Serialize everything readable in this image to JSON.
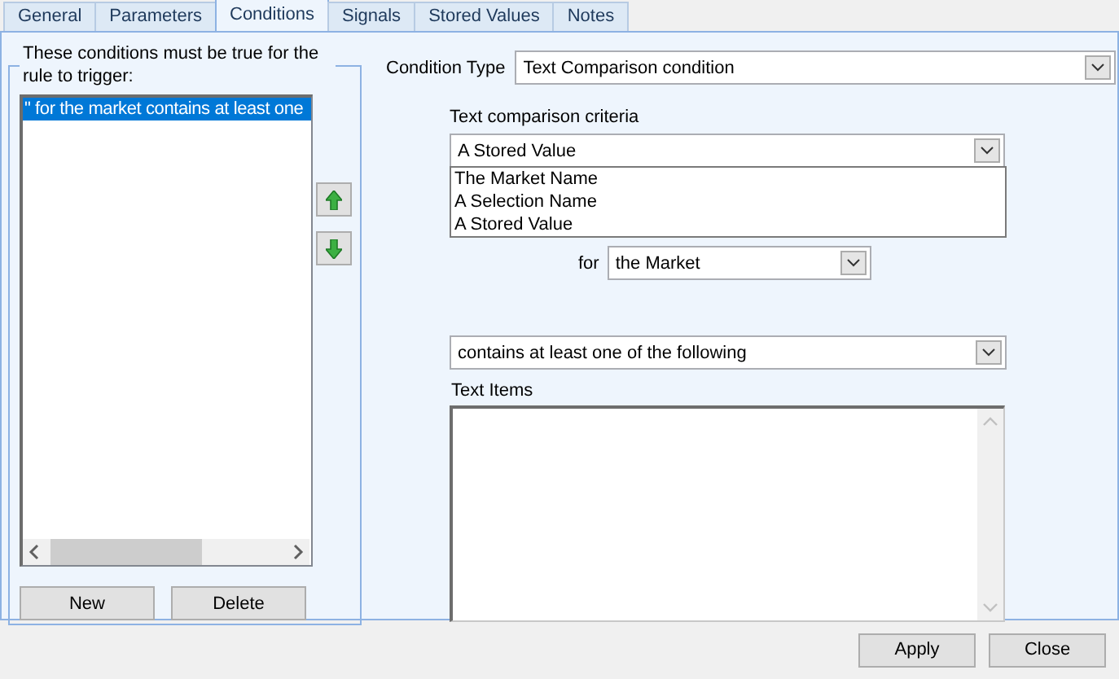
{
  "tabs": [
    {
      "label": "General",
      "selected": false
    },
    {
      "label": "Parameters",
      "selected": false
    },
    {
      "label": "Conditions",
      "selected": true
    },
    {
      "label": "Signals",
      "selected": false
    },
    {
      "label": "Stored Values",
      "selected": false
    },
    {
      "label": "Notes",
      "selected": false
    }
  ],
  "conditions_group": {
    "legend": "These conditions must be true for the rule to trigger:",
    "items": [
      {
        "text": "\" for the market contains at least one",
        "selected": true
      }
    ],
    "buttons": [
      "New",
      "Delete"
    ]
  },
  "condition_type": {
    "label": "Condition Type",
    "value": "Text Comparison condition"
  },
  "criteria": {
    "label": "Text comparison criteria",
    "value": "A Stored Value",
    "expanded": true,
    "options": [
      "The Market Name",
      "A Selection Name",
      "A Stored Value"
    ]
  },
  "for_field": {
    "label": "for",
    "value": "the Market"
  },
  "operator": {
    "value": "contains at least one of the following"
  },
  "text_items": {
    "label": "Text Items"
  },
  "footer_buttons": [
    "Apply",
    "Close"
  ]
}
